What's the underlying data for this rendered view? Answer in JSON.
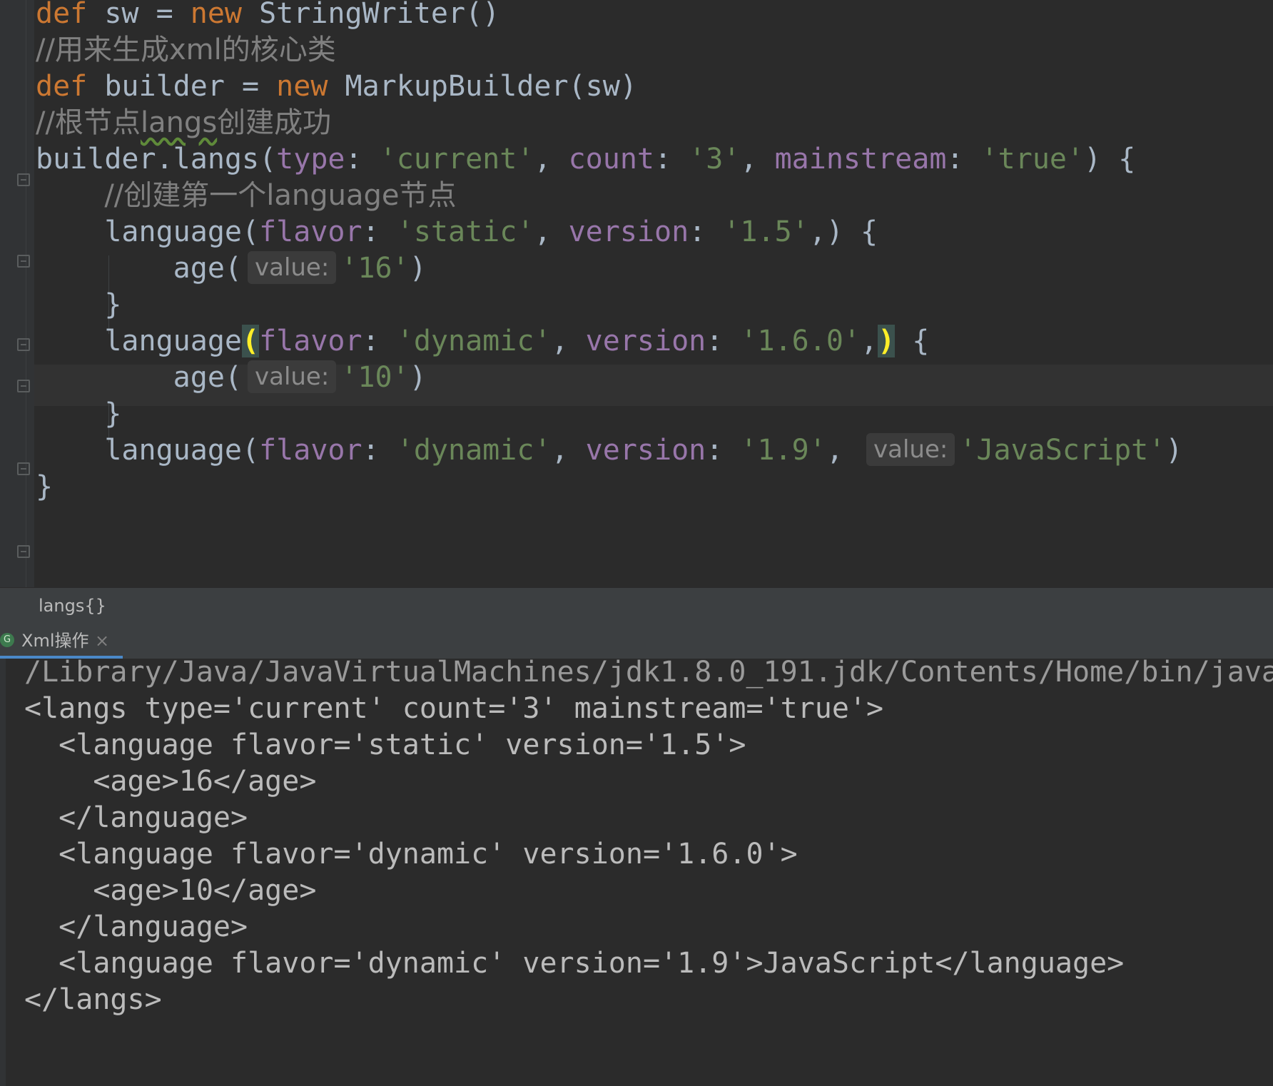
{
  "editor": {
    "lines": [
      {
        "parts": [
          [
            "kw",
            "def"
          ],
          [
            "pl",
            " sw = "
          ],
          [
            "kw",
            "new"
          ],
          [
            "pl",
            " StringWriter()"
          ]
        ]
      },
      {
        "parts": [
          [
            "cm",
            "//用来生成xml的核心类"
          ]
        ]
      },
      {
        "parts": [
          [
            "kw",
            "def"
          ],
          [
            "pl",
            " builder = "
          ],
          [
            "kw",
            "new"
          ],
          [
            "pl",
            " MarkupBuilder(sw)"
          ]
        ]
      },
      {
        "parts": [
          [
            "cm",
            "//根节点"
          ],
          [
            "cmsq",
            "langs"
          ],
          [
            "cm",
            "创建成功"
          ]
        ]
      },
      {
        "parts": [
          [
            "pl",
            "builder.langs("
          ],
          [
            "pn",
            "type"
          ],
          [
            "pl",
            ": "
          ],
          [
            "st",
            "'current'"
          ],
          [
            "pl",
            ", "
          ],
          [
            "pn",
            "count"
          ],
          [
            "pl",
            ": "
          ],
          [
            "st",
            "'3'"
          ],
          [
            "pl",
            ", "
          ],
          [
            "pn",
            "mainstream"
          ],
          [
            "pl",
            ": "
          ],
          [
            "st",
            "'true'"
          ],
          [
            "pl",
            ") {"
          ]
        ]
      },
      {
        "parts": [
          [
            "pl",
            "    "
          ],
          [
            "cm",
            "//创建第一个language节点"
          ]
        ]
      },
      {
        "parts": [
          [
            "pl",
            "    language("
          ],
          [
            "pn",
            "flavor"
          ],
          [
            "pl",
            ": "
          ],
          [
            "st",
            "'static'"
          ],
          [
            "pl",
            ", "
          ],
          [
            "pn",
            "version"
          ],
          [
            "pl",
            ": "
          ],
          [
            "st",
            "'1.5'"
          ],
          [
            "pl",
            ",) {"
          ]
        ]
      },
      {
        "parts": [
          [
            "pl",
            "        age("
          ],
          [
            "hint",
            "value:"
          ],
          [
            "st",
            "'16'"
          ],
          [
            "pl",
            ")"
          ]
        ]
      },
      {
        "parts": [
          [
            "pl",
            "    }"
          ]
        ]
      },
      {
        "parts": [
          [
            "pl",
            "    language"
          ],
          [
            "bh",
            "("
          ],
          [
            "pn",
            "flavor"
          ],
          [
            "pl",
            ": "
          ],
          [
            "st",
            "'dynamic'"
          ],
          [
            "pl",
            ", "
          ],
          [
            "pn",
            "version"
          ],
          [
            "pl",
            ": "
          ],
          [
            "st",
            "'1.6.0'"
          ],
          [
            "pl",
            ","
          ],
          [
            "bh",
            ")"
          ],
          [
            "pl",
            " {"
          ]
        ]
      },
      {
        "parts": [
          [
            "pl",
            "        age("
          ],
          [
            "hint",
            "value:"
          ],
          [
            "st",
            "'10'"
          ],
          [
            "pl",
            ")"
          ]
        ]
      },
      {
        "parts": [
          [
            "pl",
            "    }"
          ]
        ]
      },
      {
        "parts": [
          [
            "pl",
            "    language("
          ],
          [
            "pn",
            "flavor"
          ],
          [
            "pl",
            ": "
          ],
          [
            "st",
            "'dynamic'"
          ],
          [
            "pl",
            ", "
          ],
          [
            "pn",
            "version"
          ],
          [
            "pl",
            ": "
          ],
          [
            "st",
            "'1.9'"
          ],
          [
            "pl",
            ", "
          ],
          [
            "hint",
            "value:"
          ],
          [
            "st",
            "'JavaScript'"
          ],
          [
            "pl",
            ")"
          ]
        ]
      },
      {
        "parts": [
          [
            "pl",
            "}"
          ]
        ]
      }
    ]
  },
  "breadcrumb": {
    "text": "langs{}"
  },
  "run_tab": {
    "icon_letter": "G",
    "label": "Xml操作",
    "close": "×"
  },
  "console": {
    "lines": [
      "/Library/Java/JavaVirtualMachines/jdk1.8.0_191.jdk/Contents/Home/bin/java",
      "<langs type='current' count='3' mainstream='true'>",
      "  <language flavor='static' version='1.5'>",
      "    <age>16</age>",
      "  </language>",
      "  <language flavor='dynamic' version='1.6.0'>",
      "    <age>10</age>",
      "  </language>",
      "  <language flavor='dynamic' version='1.9'>JavaScript</language>",
      "</langs>"
    ]
  }
}
